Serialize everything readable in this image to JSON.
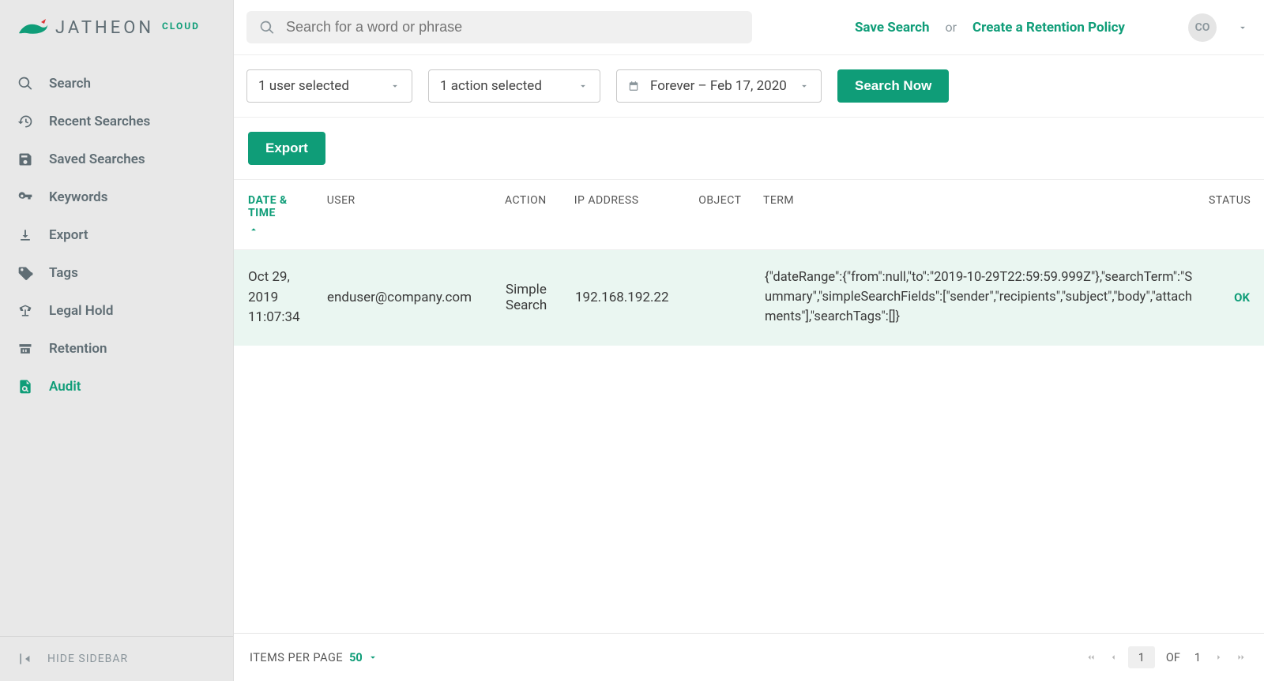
{
  "brand": {
    "name": "JATHEON",
    "suffix": "CLOUD"
  },
  "sidebar": {
    "items": [
      {
        "label": "Search"
      },
      {
        "label": "Recent Searches"
      },
      {
        "label": "Saved Searches"
      },
      {
        "label": "Keywords"
      },
      {
        "label": "Export"
      },
      {
        "label": "Tags"
      },
      {
        "label": "Legal Hold"
      },
      {
        "label": "Retention"
      },
      {
        "label": "Audit"
      }
    ],
    "hide_label": "HIDE SIDEBAR"
  },
  "topbar": {
    "search_placeholder": "Search for a word or phrase",
    "save_search": "Save Search",
    "or": "or",
    "create_policy": "Create a Retention Policy",
    "avatar_initials": "CO"
  },
  "filters": {
    "user_dd": "1 user selected",
    "action_dd": "1 action selected",
    "date_dd": "Forever – Feb 17, 2020",
    "search_now": "Search Now"
  },
  "export_button": "Export",
  "table": {
    "columns": {
      "date": "DATE & TIME",
      "user": "USER",
      "action": "ACTION",
      "ip": "IP ADDRESS",
      "object": "OBJECT",
      "term": "TERM",
      "status": "STATUS"
    },
    "rows": [
      {
        "date": "Oct 29, 2019 11:07:34",
        "user": "enduser@company.com",
        "action": "Simple Search",
        "ip": "192.168.192.22",
        "object": "",
        "term": "{\"dateRange\":{\"from\":null,\"to\":\"2019-10-29T22:59:59.999Z\"},\"searchTerm\":\"Summary\",\"simpleSearchFields\":[\"sender\",\"recipients\",\"subject\",\"body\",\"attachments\"],\"searchTags\":[]}",
        "status": "OK"
      }
    ]
  },
  "pager": {
    "ipp_label": "ITEMS PER PAGE",
    "ipp_value": "50",
    "page": "1",
    "of_label": "OF",
    "total": "1"
  }
}
